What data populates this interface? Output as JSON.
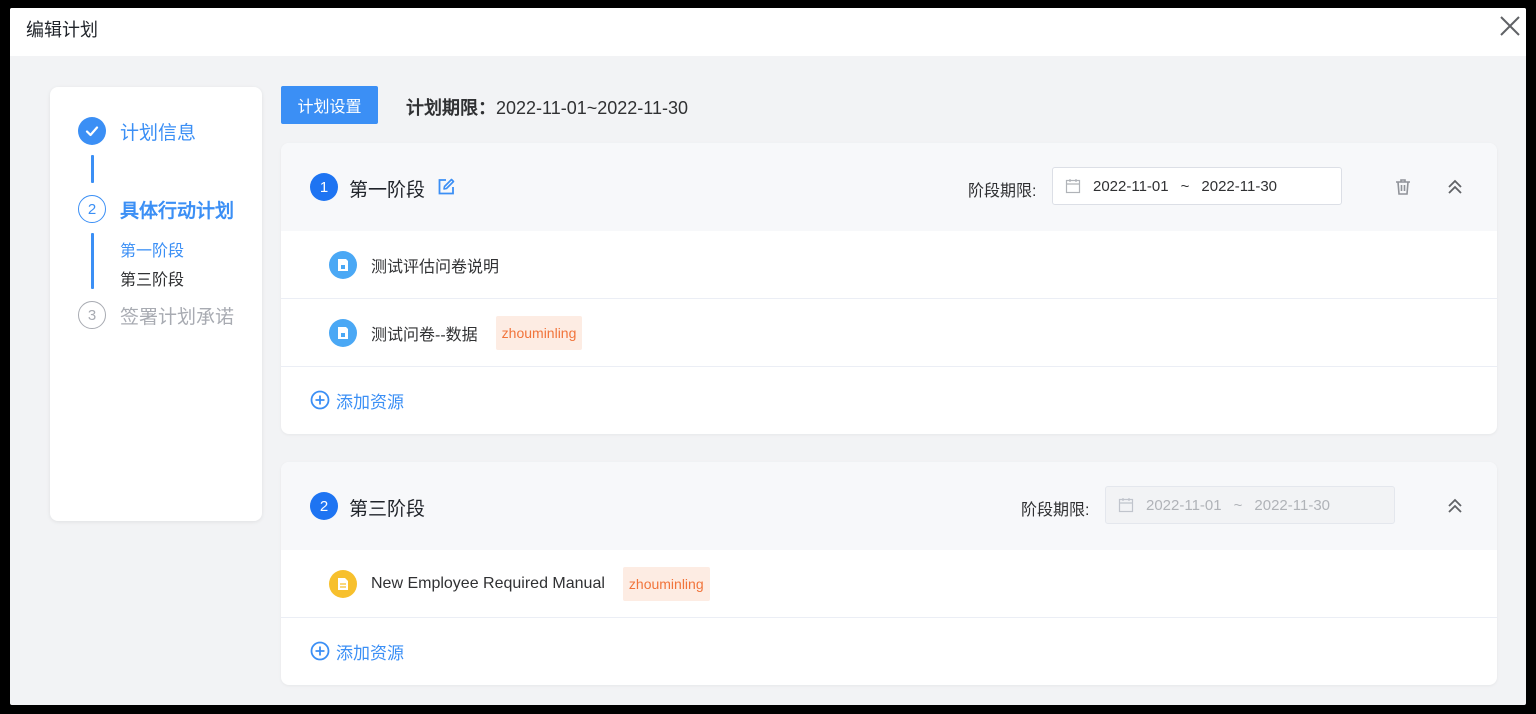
{
  "dialog": {
    "title": "编辑计划"
  },
  "steps": [
    {
      "label": "计划信息"
    },
    {
      "number": "2",
      "label": "具体行动计划",
      "sub_items": [
        "第一阶段",
        "第三阶段"
      ]
    },
    {
      "number": "3",
      "label": "签署计划承诺"
    }
  ],
  "toolbar": {
    "settings_button": "计划设置",
    "deadline_label": "计划期限：",
    "deadline_value": "2022-11-01~2022-11-30"
  },
  "stages": [
    {
      "number": "1",
      "title": "第一阶段",
      "period_label": "阶段期限:",
      "start_date": "2022-11-01",
      "separator": "~",
      "end_date": "2022-11-30",
      "disabled": false,
      "resources": [
        {
          "name": "测试评估问卷说明",
          "icon": "document-icon",
          "tag": ""
        },
        {
          "name": "测试问卷--数据",
          "icon": "document-icon",
          "tag": "zhouminling"
        }
      ],
      "add_label": "添加资源"
    },
    {
      "number": "2",
      "title": "第三阶段",
      "period_label": "阶段期限:",
      "start_date": "2022-11-01",
      "separator": "~",
      "end_date": "2022-11-30",
      "disabled": true,
      "resources": [
        {
          "name": "New Employee Required Manual",
          "icon": "file-icon",
          "tag": "zhouminling"
        }
      ],
      "add_label": "添加资源"
    }
  ],
  "colors": {
    "primary": "#3b8ff5",
    "stage_badge": "#1e74f2",
    "tag_bg": "#fdece3",
    "tag_text": "#f1743b",
    "disabled_text": "#a8abb2"
  }
}
